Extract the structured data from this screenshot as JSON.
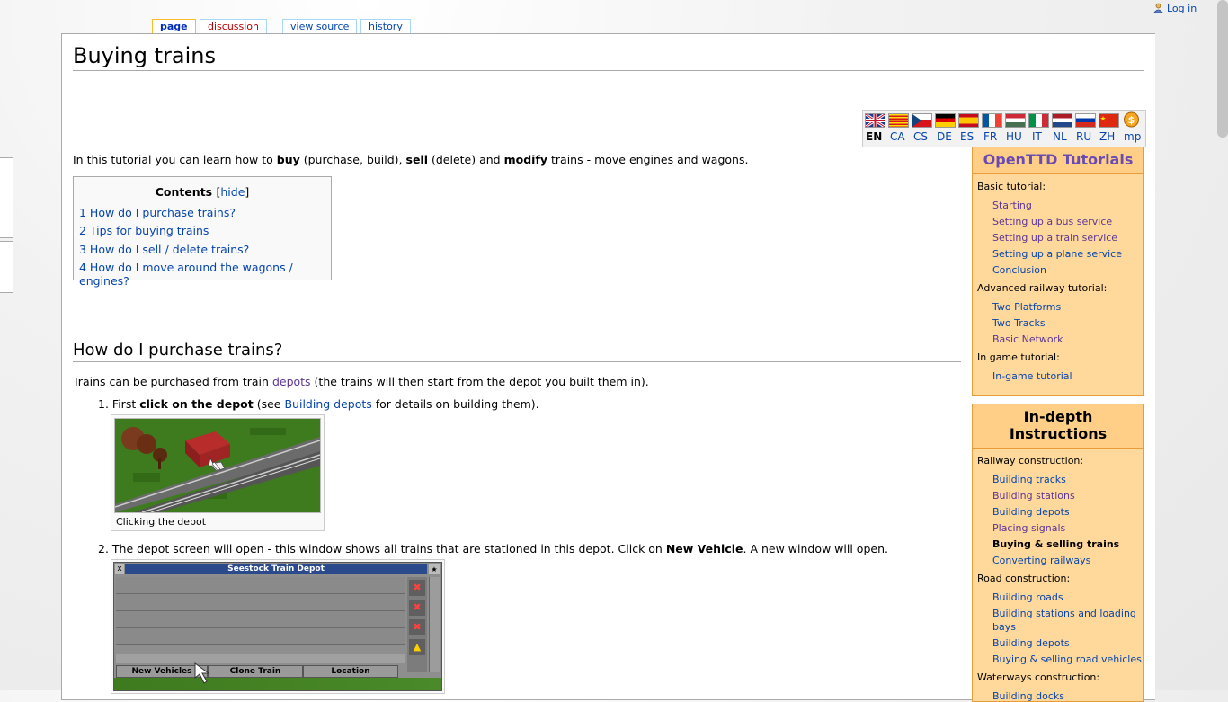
{
  "tabs": {
    "page": "page",
    "discussion": "discussion",
    "view_source": "view source",
    "history": "history"
  },
  "user": {
    "login": "Log in",
    "icon": "user-icon"
  },
  "article": {
    "title": "Buying trains",
    "intro": {
      "t1": "In this tutorial you can learn how to ",
      "buy": "buy",
      "t2": " (purchase, build), ",
      "sell": "sell",
      "t3": " (delete) and ",
      "modify": "modify",
      "t4": " trains - move engines and wagons."
    },
    "toc": {
      "title": "Contents",
      "lb": "[",
      "hide": "hide",
      "rb": "]",
      "items": [
        "1 How do I purchase trains?",
        "2 Tips for buying trains",
        "3 How do I sell / delete trains?",
        "4 How do I move around the wagons / engines?"
      ]
    },
    "section1": {
      "heading": "How do I purchase trains?",
      "p1_a": "Trains can be purchased from train ",
      "p1_link": "depots",
      "p1_b": " (the trains will then start from the depot you built them in).",
      "step1": {
        "num": "1.",
        "a": "First ",
        "bold": "click on the depot",
        "b": " (see ",
        "link": "Building depots",
        "c": " for details on building them)."
      },
      "caption1": "Clicking the depot",
      "step2": {
        "num": "2.",
        "a": "The depot screen will open - this window shows all trains that are stationed in this depot. Click on ",
        "bold": "New Vehicle",
        "b": ". A new window will open."
      },
      "depot_window": {
        "title": "Seestock Train Depot",
        "close": "x",
        "btn_new": "New Vehicles",
        "btn_clone": "Clone Train",
        "btn_location": "Location"
      }
    }
  },
  "languages": [
    "EN",
    "CA",
    "CS",
    "DE",
    "ES",
    "FR",
    "HU",
    "IT",
    "NL",
    "RU",
    "ZH",
    "mp"
  ],
  "sidebar": {
    "box1": {
      "title": "OpenTTD Tutorials",
      "sections": [
        {
          "label": "Basic tutorial:",
          "links": [
            "Starting",
            "Setting up a bus service",
            "Setting up a train service",
            "Setting up a plane service",
            "Conclusion"
          ]
        },
        {
          "label": "Advanced railway tutorial:",
          "links": [
            "Two Platforms",
            "Two Tracks",
            "Basic Network"
          ]
        },
        {
          "label": "In game tutorial:",
          "links": [
            "In-game tutorial"
          ]
        }
      ]
    },
    "box2": {
      "title": "In-depth Instructions",
      "sections": [
        {
          "label": "Railway construction:",
          "links": [
            "Building tracks",
            "Building stations",
            "Building depots",
            "Placing signals",
            "Buying & selling trains",
            "Converting railways"
          ]
        },
        {
          "label": "Road construction:",
          "links": [
            "Building roads",
            "Building stations and loading",
            "bays",
            "Building depots",
            "Buying & selling road vehicles"
          ]
        },
        {
          "label": "Waterways construction:",
          "links": [
            "Building docks"
          ]
        }
      ]
    }
  }
}
